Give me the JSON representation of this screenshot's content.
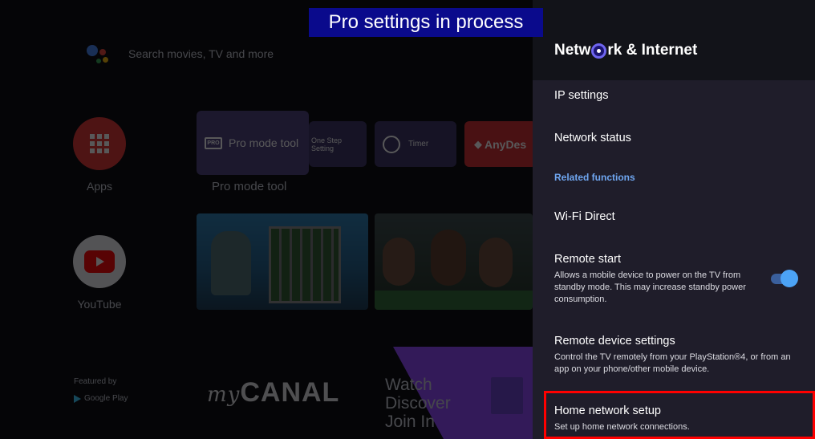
{
  "banner": "Pro settings in process",
  "home": {
    "search_placeholder": "Search movies, TV and more",
    "apps_label": "Apps",
    "youtube_label": "YouTube",
    "featured_by": "Featured by",
    "google_play": "Google Play",
    "tiles": {
      "pro_mode": "Pro mode tool",
      "one_step_line1": "One Step",
      "one_step_line2": "Setting",
      "timer": "Timer",
      "anydesk": "AnyDes"
    },
    "selected_tile_label": "Pro mode tool",
    "mycanal_my": "my",
    "mycanal_canal": "CANAL",
    "twitch_line1": "Watch",
    "twitch_line2": "Discover",
    "twitch_line3": "Join In"
  },
  "panel": {
    "title_before": "Netw",
    "title_after": "rk & Internet",
    "items": [
      {
        "title": "IP settings"
      },
      {
        "title": "Network status"
      },
      {
        "title": "Wi-Fi Direct"
      },
      {
        "title": "Remote start",
        "desc": "Allows a mobile device to power on the TV from standby mode. This may increase standby power consumption."
      },
      {
        "title": "Remote device settings",
        "desc": "Control the TV remotely from your PlayStation®4, or from an app on your phone/other mobile device."
      },
      {
        "title": "Home network setup",
        "desc": "Set up home network connections."
      }
    ],
    "section_related": "Related functions",
    "remote_start_on": true
  },
  "colors": {
    "panel_bg": "#1f1d2a",
    "header_bg": "#121319",
    "accent_blue": "#6fa6f0",
    "toggle_on": "#4ca3f5",
    "focus_red": "#ff0000",
    "banner_bg": "#0a0a8c"
  }
}
